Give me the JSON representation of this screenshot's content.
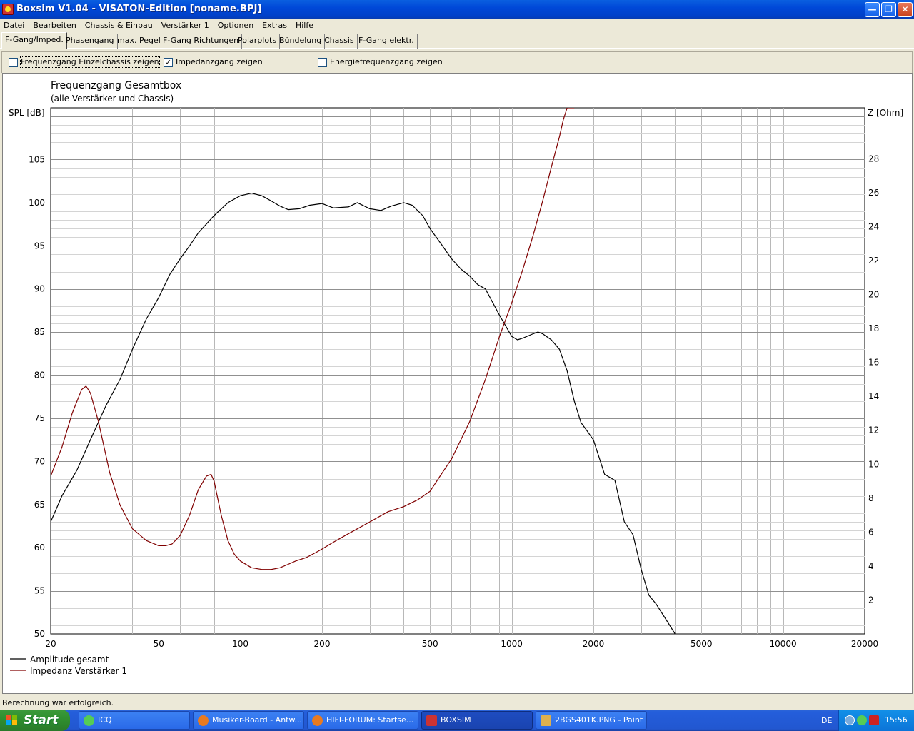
{
  "window": {
    "title": "Boxsim V1.04 - VISATON-Edition [noname.BPJ]"
  },
  "menu": [
    "Datei",
    "Bearbeiten",
    "Chassis & Einbau",
    "Verstärker 1",
    "Optionen",
    "Extras",
    "Hilfe"
  ],
  "tabs": [
    {
      "label": "F-Gang/Imped.",
      "active": true
    },
    {
      "label": "Phasengang",
      "active": false
    },
    {
      "label": "max. Pegel",
      "active": false
    },
    {
      "label": "F-Gang Richtungen",
      "active": false
    },
    {
      "label": "Polarplots",
      "active": false
    },
    {
      "label": "Bündelung",
      "active": false
    },
    {
      "label": "Chassis",
      "active": false
    },
    {
      "label": "F-Gang elektr.",
      "active": false
    }
  ],
  "options": [
    {
      "label": "Frequenzgang Einzelchassis zeigen",
      "checked": false
    },
    {
      "label": "Impedanzgang zeigen",
      "checked": true
    },
    {
      "label": "Energiefrequenzgang zeigen",
      "checked": false
    }
  ],
  "status": "Berechnung war erfolgreich.",
  "chart_data": {
    "type": "line",
    "title": "Frequenzgang Gesamtbox",
    "subtitle": "(alle Verstärker und Chassis)",
    "ylabel": "SPL [dB]",
    "y2label": "Z [Ohm]",
    "xscale": "log",
    "xlim": [
      20,
      20000
    ],
    "ylim": [
      50,
      111
    ],
    "y2lim": [
      0,
      31
    ],
    "xticks": [
      20,
      50,
      100,
      200,
      500,
      1000,
      2000,
      5000,
      10000,
      20000
    ],
    "yticks": [
      50,
      55,
      60,
      65,
      70,
      75,
      80,
      85,
      90,
      95,
      100,
      105
    ],
    "y2ticks": [
      2,
      4,
      6,
      8,
      10,
      12,
      14,
      16,
      18,
      20,
      22,
      24,
      26,
      28
    ],
    "grid": true,
    "legend_position": "bottom-left",
    "series": [
      {
        "name": "Amplitude gesamt",
        "axis": "left",
        "color": "#000000",
        "x": [
          20,
          22,
          25,
          28,
          32,
          36,
          40,
          45,
          50,
          55,
          60,
          65,
          70,
          80,
          90,
          100,
          110,
          120,
          130,
          140,
          150,
          165,
          180,
          200,
          220,
          250,
          270,
          300,
          330,
          360,
          400,
          430,
          470,
          500,
          550,
          600,
          650,
          700,
          750,
          800,
          900,
          1000,
          1050,
          1100,
          1200,
          1250,
          1300,
          1400,
          1500,
          1600,
          1700,
          1800,
          1900,
          2000,
          2200,
          2400,
          2600,
          2800,
          3000,
          3200,
          3400,
          3700,
          4000
        ],
        "y": [
          63,
          66,
          69,
          72.5,
          76.5,
          79.5,
          83,
          86.5,
          89,
          91.7,
          93.5,
          95,
          96.5,
          98.5,
          100,
          100.8,
          101.1,
          100.8,
          100.2,
          99.6,
          99.2,
          99.3,
          99.7,
          99.9,
          99.4,
          99.5,
          100,
          99.3,
          99.1,
          99.6,
          100,
          99.7,
          98.5,
          97,
          95.2,
          93.5,
          92.3,
          91.5,
          90.5,
          90,
          87,
          84.5,
          84.1,
          84.3,
          84.8,
          85,
          84.8,
          84.1,
          83,
          80.5,
          77,
          74.5,
          73.5,
          72.5,
          68.5,
          67.8,
          63,
          61.5,
          57.5,
          54.5,
          53.5,
          51.7,
          50
        ]
      },
      {
        "name": "Impedanz Verstärker 1",
        "axis": "right",
        "color": "#800000",
        "x": [
          20,
          22,
          24,
          26,
          27,
          28,
          30,
          33,
          36,
          40,
          45,
          50,
          53,
          56,
          60,
          65,
          70,
          75,
          78,
          80,
          85,
          90,
          95,
          100,
          110,
          120,
          130,
          140,
          150,
          160,
          175,
          190,
          200,
          220,
          250,
          300,
          350,
          400,
          450,
          500,
          550,
          600,
          700,
          800,
          900,
          1000,
          1100,
          1200,
          1300,
          1400,
          1500,
          1550,
          1600,
          1700
        ],
        "y": [
          9.3,
          11,
          13,
          14.4,
          14.6,
          14.2,
          12.5,
          9.5,
          7.6,
          6.2,
          5.5,
          5.2,
          5.2,
          5.3,
          5.8,
          7,
          8.5,
          9.3,
          9.4,
          9,
          7,
          5.5,
          4.7,
          4.3,
          3.9,
          3.8,
          3.8,
          3.9,
          4.1,
          4.3,
          4.5,
          4.8,
          5,
          5.4,
          5.9,
          6.6,
          7.2,
          7.5,
          7.9,
          8.4,
          9.4,
          10.3,
          12.5,
          15,
          17.5,
          19.5,
          21.5,
          23.5,
          25.5,
          27.5,
          29.3,
          30.3,
          31,
          31
        ]
      }
    ]
  }
}
